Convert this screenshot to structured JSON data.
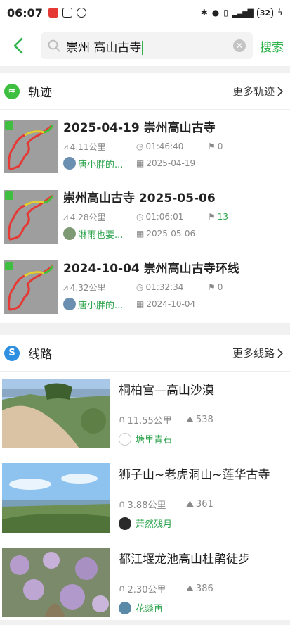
{
  "status_bar": {
    "time": "06:07",
    "battery": "32"
  },
  "search": {
    "query": "崇州 高山古寺",
    "button_label": "搜索"
  },
  "tracks_section": {
    "title": "轨迹",
    "more_label": "更多轨迹",
    "items": [
      {
        "title": "2025-04-19 崇州高山古寺",
        "distance": "4.11公里",
        "duration": "01:46:40",
        "waypoints": "0",
        "user": "唐小胖的...",
        "date": "2025-04-19"
      },
      {
        "title": "崇州高山古寺 2025-05-06",
        "distance": "4.28公里",
        "duration": "01:06:01",
        "waypoints": "13",
        "user": "淋雨也要...",
        "date": "2025-05-06"
      },
      {
        "title": "2024-10-04 崇州高山古寺环线",
        "distance": "4.32公里",
        "duration": "01:32:34",
        "waypoints": "0",
        "user": "唐小胖的...",
        "date": "2024-10-04"
      }
    ]
  },
  "routes_section": {
    "title": "线路",
    "more_label": "更多线路",
    "items": [
      {
        "title": "桐柏宫—高山沙漠",
        "distance": "11.55公里",
        "views": "538",
        "user": "塘里青石"
      },
      {
        "title": "狮子山~老虎洞山~莲华古寺",
        "distance": "3.88公里",
        "views": "361",
        "user": "萧然残月"
      },
      {
        "title": "都江堰龙池高山杜鹃徒步",
        "distance": "2.30公里",
        "views": "386",
        "user": "花燚再"
      }
    ]
  },
  "colors": {
    "accent": "#2db34a"
  }
}
